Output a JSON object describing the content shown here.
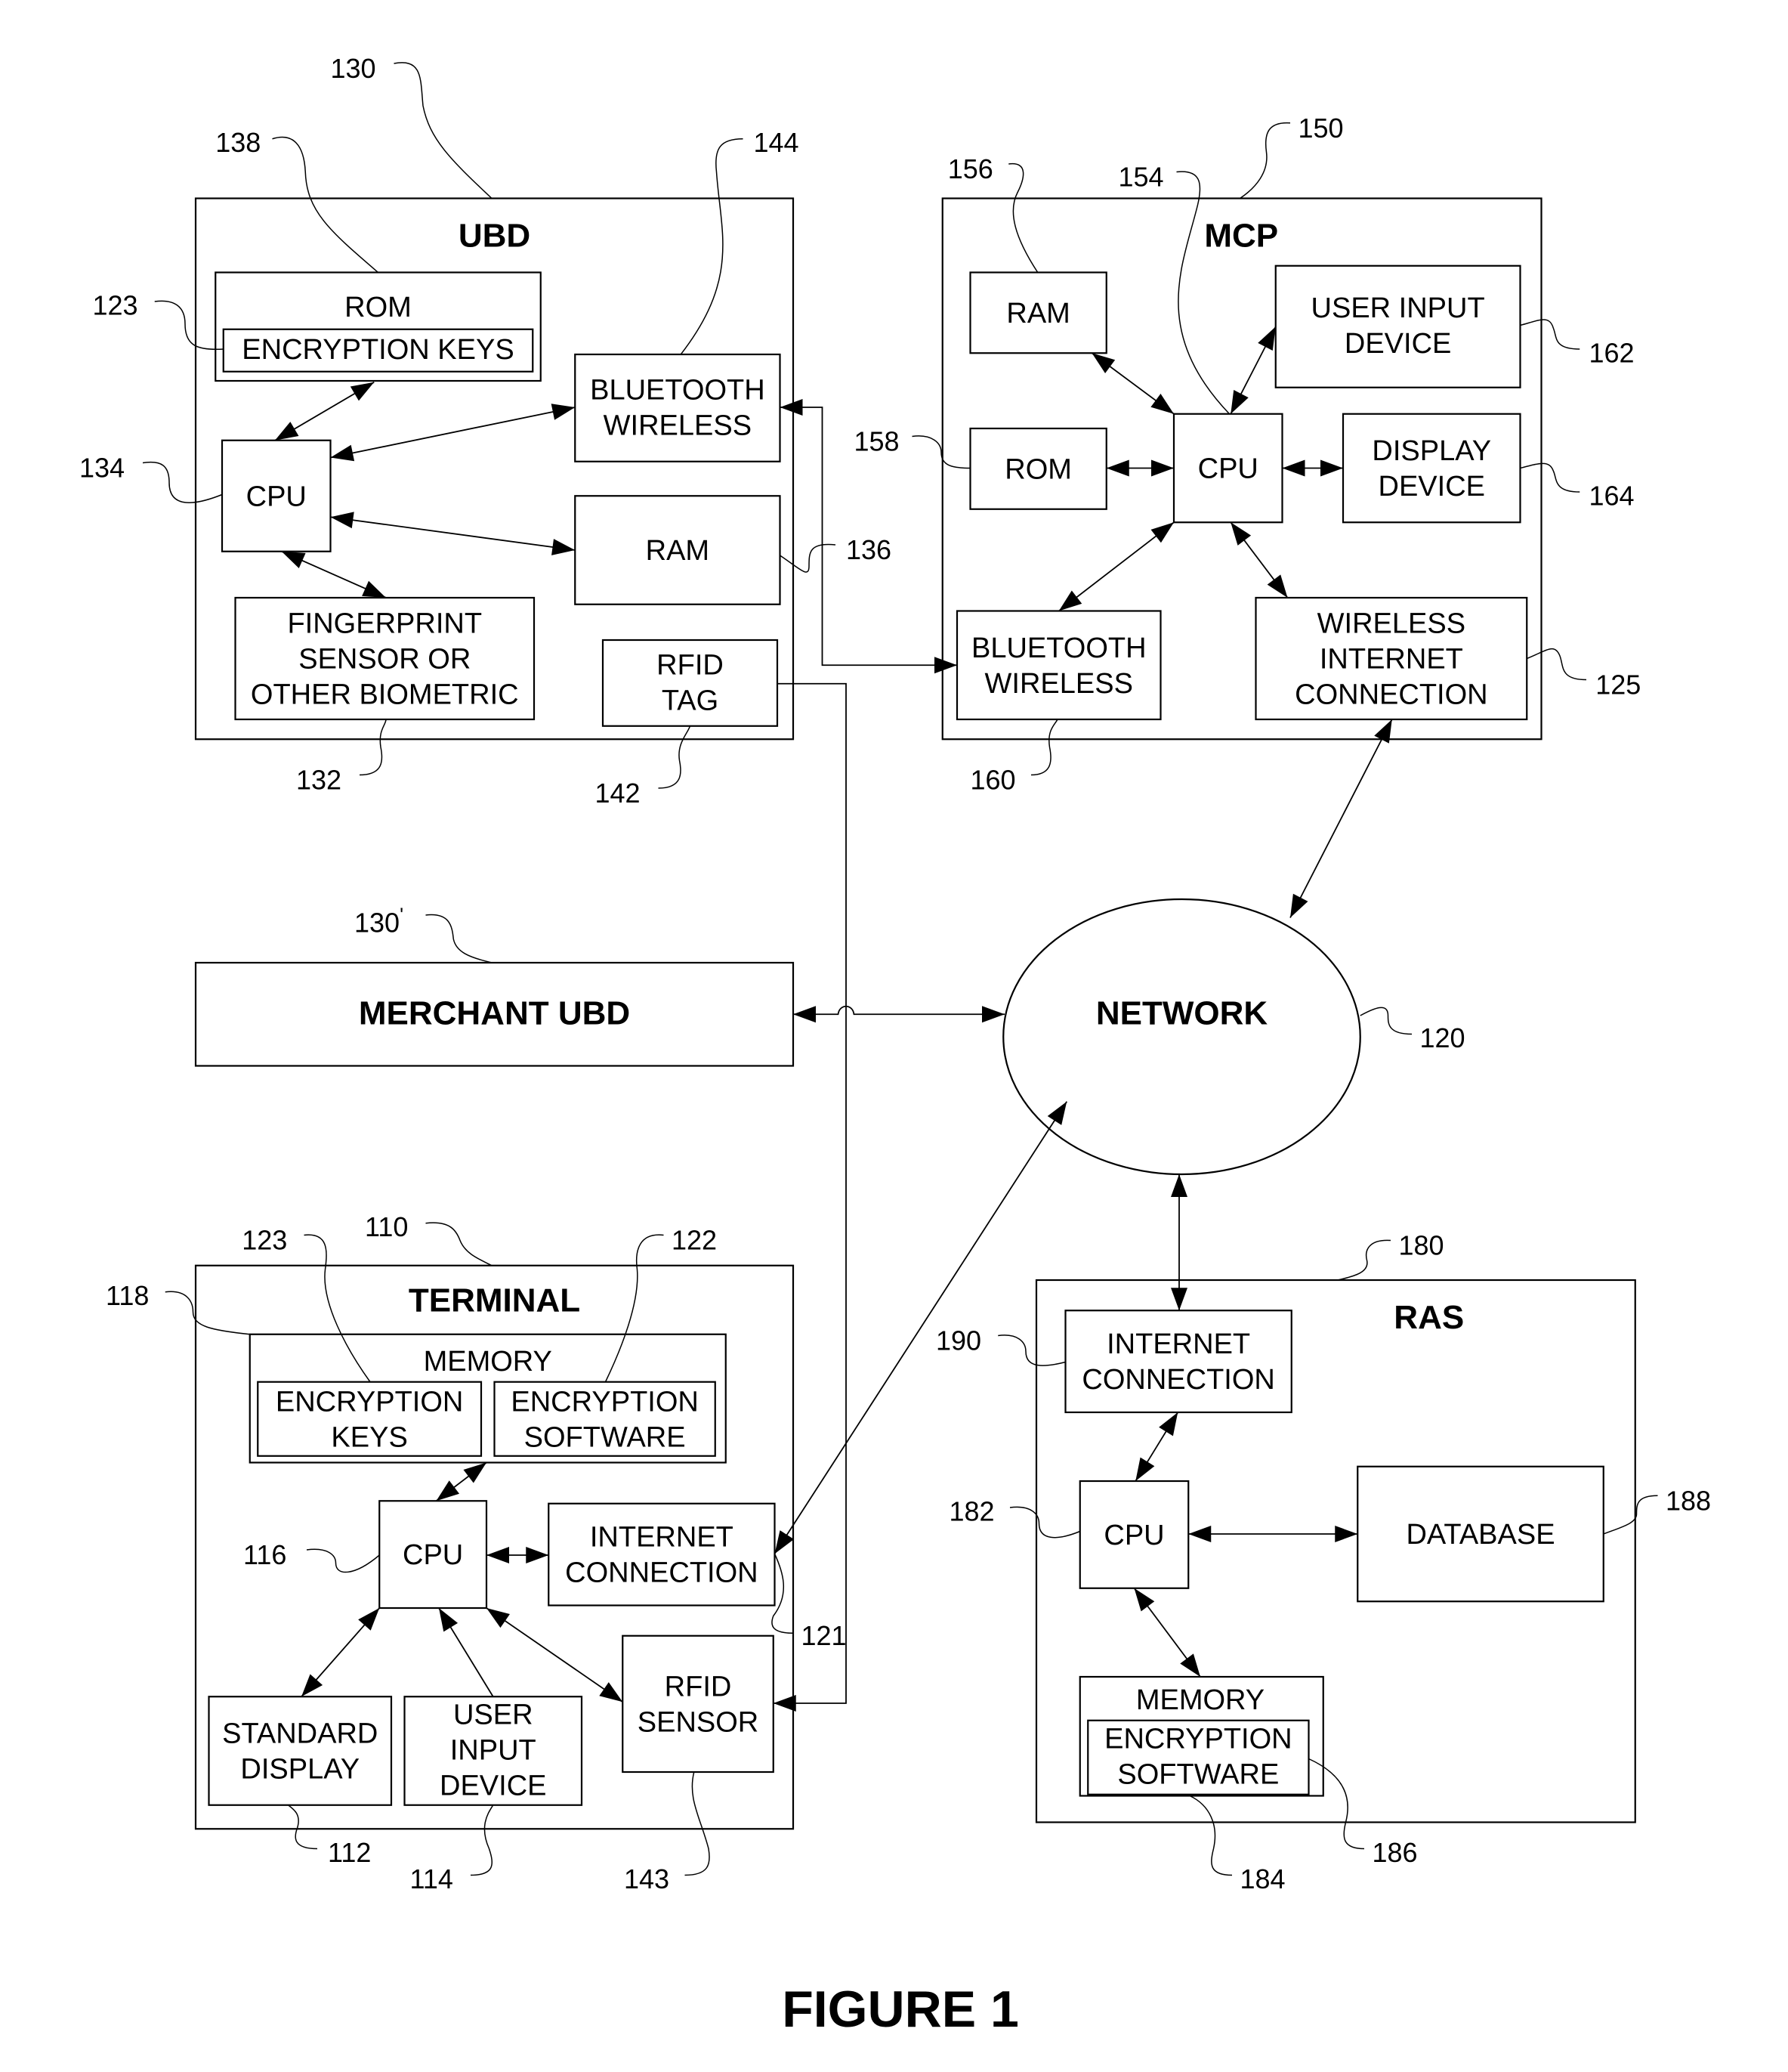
{
  "figure": {
    "caption": "FIGURE 1"
  },
  "ubd": {
    "title": "UBD",
    "ref": "130",
    "rom": {
      "lines": [
        "ROM"
      ],
      "ref": "138"
    },
    "encryption_keys": {
      "lines": [
        "ENCRYPTION KEYS"
      ],
      "ref": "123"
    },
    "cpu": {
      "lines": [
        "CPU"
      ],
      "ref": "134"
    },
    "bluetooth": {
      "lines": [
        "BLUETOOTH",
        "WIRELESS"
      ],
      "ref": "144"
    },
    "ram": {
      "lines": [
        "RAM"
      ],
      "ref": "136"
    },
    "fingerprint": {
      "lines": [
        "FINGERPRINT",
        "SENSOR OR",
        "OTHER BIOMETRIC"
      ],
      "ref": "132"
    },
    "rfid_tag": {
      "lines": [
        "RFID",
        "TAG"
      ],
      "ref": "142"
    }
  },
  "mcp": {
    "title": "MCP",
    "ref": "150",
    "ram": {
      "lines": [
        "RAM"
      ],
      "ref": "156"
    },
    "cpu": {
      "lines": [
        "CPU"
      ],
      "ref": "154"
    },
    "user_input": {
      "lines": [
        "USER INPUT",
        "DEVICE"
      ],
      "ref": "162"
    },
    "rom": {
      "lines": [
        "ROM"
      ],
      "ref": "158"
    },
    "display": {
      "lines": [
        "DISPLAY",
        "DEVICE"
      ],
      "ref": "164"
    },
    "bluetooth": {
      "lines": [
        "BLUETOOTH",
        "WIRELESS"
      ],
      "ref": "160"
    },
    "wireless_internet": {
      "lines": [
        "WIRELESS",
        "INTERNET",
        "CONNECTION"
      ],
      "ref": "125"
    }
  },
  "merchant_ubd": {
    "title": "MERCHANT UBD",
    "ref": "130",
    "ref_prime": "'"
  },
  "network": {
    "title": "NETWORK",
    "ref": "120"
  },
  "terminal": {
    "title": "TERMINAL",
    "ref": "110",
    "memory": {
      "lines": [
        "MEMORY"
      ],
      "ref": "118"
    },
    "encryption_keys": {
      "lines": [
        "ENCRYPTION",
        "KEYS"
      ],
      "ref": "123"
    },
    "encryption_software": {
      "lines": [
        "ENCRYPTION",
        "SOFTWARE"
      ],
      "ref": "122"
    },
    "cpu": {
      "lines": [
        "CPU"
      ],
      "ref": "116"
    },
    "internet": {
      "lines": [
        "INTERNET",
        "CONNECTION"
      ],
      "ref": "121"
    },
    "standard_display": {
      "lines": [
        "STANDARD",
        "DISPLAY"
      ],
      "ref": "112"
    },
    "user_input": {
      "lines": [
        "USER",
        "INPUT",
        "DEVICE"
      ],
      "ref": "114"
    },
    "rfid_sensor": {
      "lines": [
        "RFID",
        "SENSOR"
      ],
      "ref": "143"
    }
  },
  "ras": {
    "title": "RAS",
    "ref": "180",
    "internet": {
      "lines": [
        "INTERNET",
        "CONNECTION"
      ],
      "ref": "190"
    },
    "cpu": {
      "lines": [
        "CPU"
      ],
      "ref": "182"
    },
    "database": {
      "lines": [
        "DATABASE"
      ],
      "ref": "188"
    },
    "memory": {
      "lines": [
        "MEMORY"
      ],
      "ref": "184"
    },
    "encryption_software": {
      "lines": [
        "ENCRYPTION",
        "SOFTWARE"
      ],
      "ref": "186"
    }
  }
}
